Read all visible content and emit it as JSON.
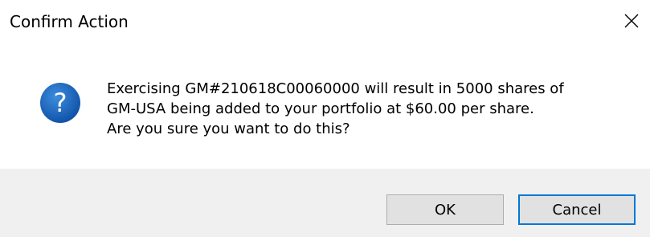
{
  "window": {
    "title": "Confirm Action",
    "close_icon": "close-icon"
  },
  "content": {
    "icon": "question-icon",
    "icon_glyph": "?",
    "icon_color": "#1565c0",
    "message_lines": [
      "Exercising GM#210618C00060000 will result in 5000 shares of",
      "GM-USA being added to your portfolio at $60.00 per share.",
      "Are you sure you want to do this?"
    ]
  },
  "buttons": {
    "ok_label": "OK",
    "cancel_label": "Cancel",
    "default_button_border": "#0078d7"
  }
}
